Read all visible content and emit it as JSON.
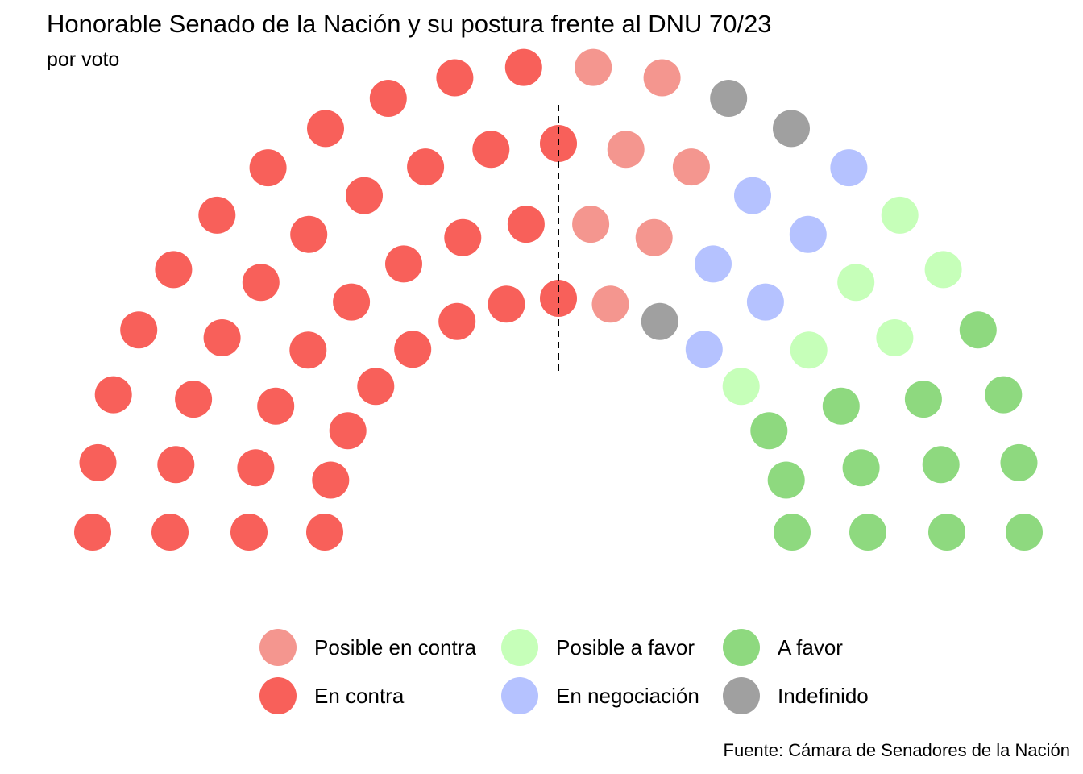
{
  "header": {
    "title": "Honorable Senado de la Nación y su postura frente al DNU 70/23",
    "subtitle": "por voto"
  },
  "footer": {
    "caption": "Fuente: Cámara de Senadores de la Nación"
  },
  "chart_data": {
    "type": "parliament",
    "total_seats": 72,
    "series": [
      {
        "name": "En contra",
        "values": [
          37
        ],
        "color": "#F8605A"
      },
      {
        "name": "Posible en contra",
        "values": [
          7
        ],
        "color": "#F4968F"
      },
      {
        "name": "Indefinido",
        "values": [
          3
        ],
        "color": "#A0A0A0"
      },
      {
        "name": "En negociación",
        "values": [
          6
        ],
        "color": "#B5C2FF"
      },
      {
        "name": "Posible a favor",
        "values": [
          6
        ],
        "color": "#C6FFB9"
      },
      {
        "name": "A favor",
        "values": [
          13
        ],
        "color": "#8ED97F"
      }
    ],
    "seat_order_left_to_right": [
      "En contra",
      "Posible en contra",
      "Indefinido",
      "En negociación",
      "Posible a favor",
      "A favor"
    ],
    "majority_line": "dashed vertical at center",
    "legend": {
      "position": "bottom",
      "order": [
        "Posible en contra",
        "Posible a favor",
        "A favor",
        "En contra",
        "En negociación",
        "Indefinido"
      ]
    }
  }
}
